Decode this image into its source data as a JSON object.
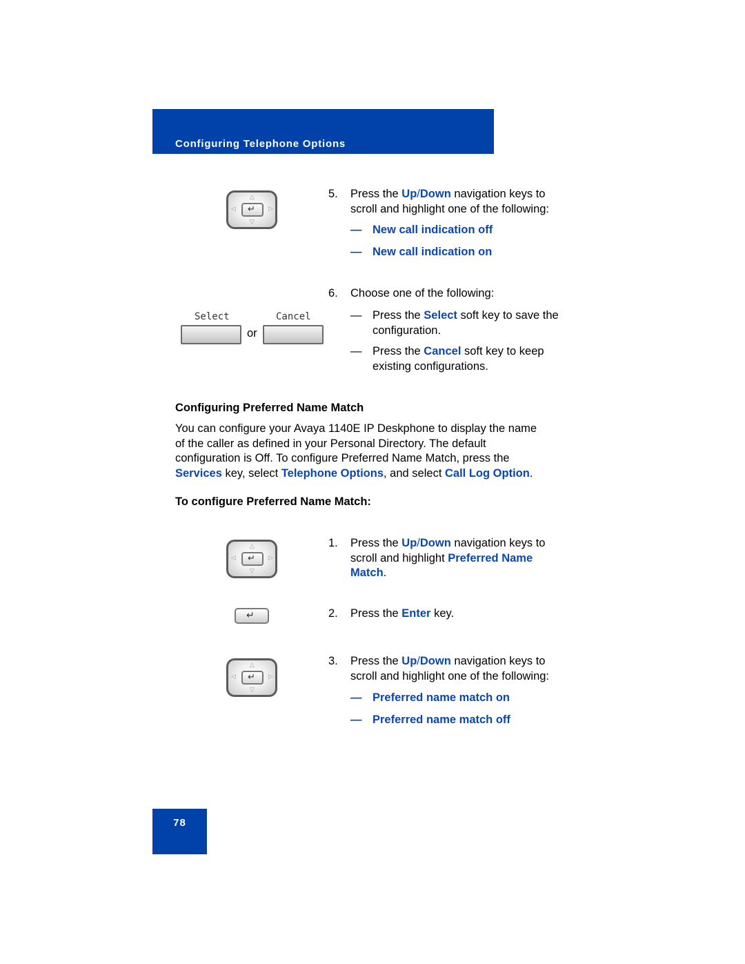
{
  "header": {
    "title": "Configuring Telephone Options",
    "band_color": "#0041aa"
  },
  "accent_color": "#0a47b0",
  "step5": {
    "number": "5.",
    "text_before": "Press the ",
    "up": "Up",
    "slash": "/",
    "down": "Down",
    "text_after": " navigation keys to",
    "line2": "scroll and highlight one of the following:",
    "options": [
      "New call indication off",
      "New call indication on"
    ]
  },
  "step6": {
    "number": "6.",
    "text": "Choose one of the following:",
    "choices": [
      {
        "before": "Press the ",
        "key": "Select",
        "after": " soft key to save the",
        "line2": "configuration."
      },
      {
        "before": "Press the ",
        "key": "Cancel",
        "after": " soft key to keep",
        "line2": "existing configurations."
      }
    ]
  },
  "softkeys": {
    "select_label": "Select",
    "cancel_label": "Cancel",
    "or": "or"
  },
  "section": {
    "heading": "Configuring Preferred Name Match",
    "para_line1": "You can configure your Avaya 1140E IP Deskphone to display the name",
    "para_line2": "of the caller as defined in your Personal Directory. The default",
    "para_line3": "configuration is Off. To configure Preferred Name Match, press the",
    "para_line4": {
      "services": "Services",
      "t1": " key, select ",
      "telephone_options": "Telephone Options",
      "t2": ", and select ",
      "call_log": "Call Log Option",
      "t3": "."
    },
    "procedure_heading": "To configure Preferred Name Match:"
  },
  "proc": {
    "step1": {
      "number": "1.",
      "before": "Press the ",
      "up": "Up",
      "slash": "/",
      "down": "Down",
      "after": " navigation keys to",
      "line2_before": "scroll and highlight ",
      "line2_blue": "Preferred Name",
      "line3_blue": "Match",
      "line3_after": "."
    },
    "step2": {
      "number": "2.",
      "before": "Press the ",
      "key": "Enter",
      "after": " key."
    },
    "step3": {
      "number": "3.",
      "before": "Press the ",
      "up": "Up",
      "slash": "/",
      "down": "Down",
      "after": " navigation keys to",
      "line2": "scroll and highlight one of the following:",
      "options": [
        "Preferred name match on",
        "Preferred name match off"
      ]
    }
  },
  "dash": "—",
  "icons": {
    "enter": "↵",
    "up": "△",
    "down": "▽",
    "left": "◁",
    "right": "▷"
  },
  "page_number": "78"
}
